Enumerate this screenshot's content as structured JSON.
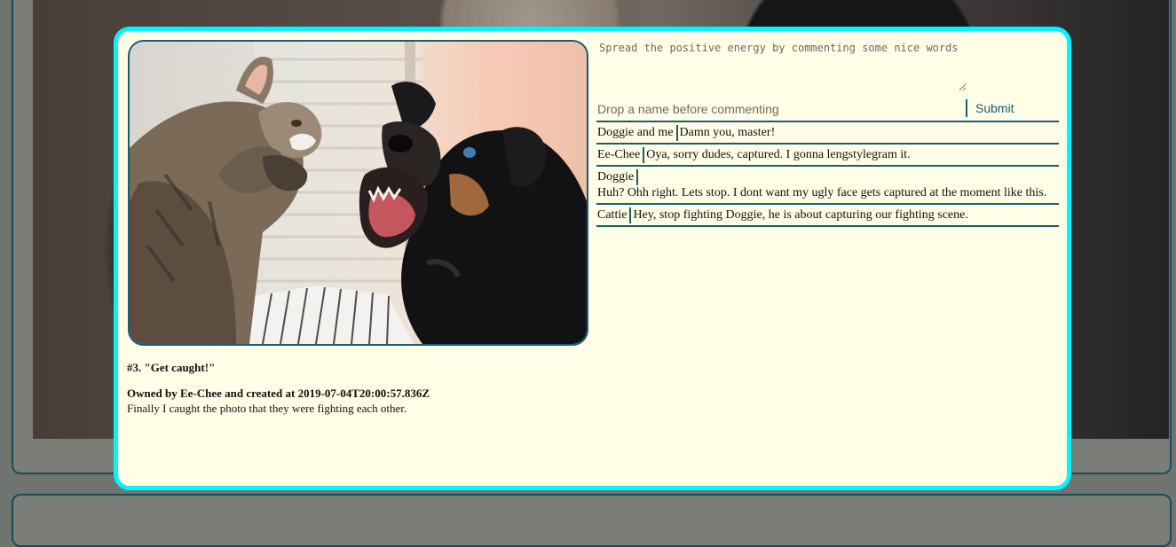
{
  "post": {
    "title": "#3. \"Get caught!\"",
    "meta": "Owned by Ee-Chee and created at 2019-07-04T20:00:57.836Z",
    "description": "Finally I caught the photo that they were fighting each other."
  },
  "comment_form": {
    "comment_placeholder": "Spread the positive energy by commenting some nice words",
    "name_placeholder": "Drop a name before commenting",
    "submit_label": "Submit"
  },
  "comments": [
    {
      "author": "Doggie and me",
      "text": "Damn you, master!"
    },
    {
      "author": "Ee-Chee",
      "text": "Oya, sorry dudes, captured. I gonna lengstylegram it."
    },
    {
      "author": "Doggie",
      "text": "Huh? Ohh right. Lets stop. I dont want my ugly face gets captured at the moment like this."
    },
    {
      "author": "Cattie",
      "text": "Hey, stop fighting Doggie, he is about capturing our fighting scene."
    }
  ],
  "colors": {
    "modal_border": "#00f5ff",
    "modal_background": "#fffee6",
    "accent": "#1b5d72"
  }
}
